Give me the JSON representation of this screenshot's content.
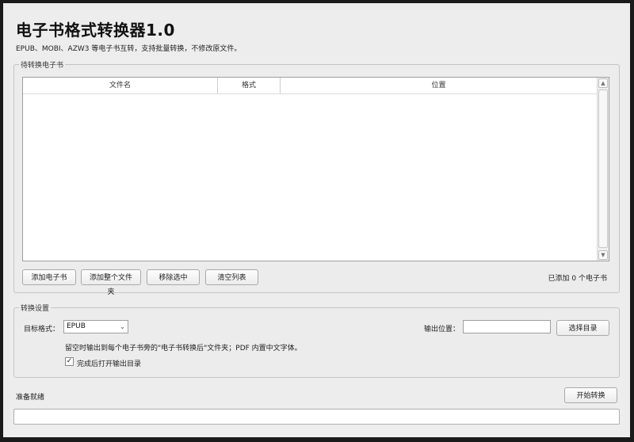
{
  "app": {
    "title": "电子书格式转换器1.0",
    "subtitle": "EPUB、MOBI、AZW3 等电子书互转，支持批量转换，不修改原文件。"
  },
  "queue": {
    "group_label": "待转换电子书",
    "columns": [
      "文件名",
      "格式",
      "位置"
    ],
    "rows": [],
    "buttons": {
      "add": "添加电子书",
      "add_folder": "添加整个文件夹",
      "remove_selected": "移除选中",
      "clear_list": "清空列表"
    },
    "count_prefix": "已添加",
    "count_value": "0",
    "count_suffix": "个电子书"
  },
  "settings": {
    "group_label": "转换设置",
    "target_format_label": "目标格式：",
    "target_format_value": "EPUB",
    "output_label": "输出位置：",
    "output_value": "",
    "choose_dir_button": "选择目录",
    "hint": "留空时输出到每个电子书旁的\"电子书转换后\"文件夹；PDF 内置中文字体。",
    "open_after_label": "完成后打开输出目录",
    "open_after_checked": true
  },
  "footer": {
    "status": "准备就绪",
    "start_button": "开始转换",
    "progress": 0
  }
}
